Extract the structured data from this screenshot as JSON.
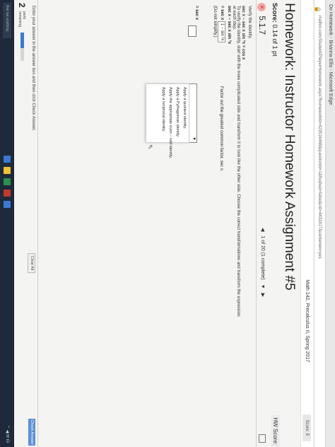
{
  "browser": {
    "tab_text": "Do Homework - Brianna Ellis - Microsoft Edge",
    "url": "mathxl.com/Student/PlayerHomework.aspx?homeworkId=423516468&questionId=1&flushed=false&cId=4431817&centerwin=yes"
  },
  "course": {
    "name": "Math 142, Precalculus II, Spring 2017",
    "right_icon_label": "Score: E"
  },
  "homework": {
    "title": "Homework: Instructor Homework Assignment #5",
    "score_label": "Score:",
    "score_value": "0.14 of 1 pt",
    "hw_score": "HW Score:",
    "question_number": "5.1.7",
    "nav_text": "1 of 20 (1 complete)"
  },
  "problem": {
    "instruction": "Verify the identity.",
    "identity": "sec x − sec x sin ²x = cos x",
    "description": "To verify the identity, start with the more complicated side and transform it to look like the other side. Choose the correct transformations and transform the expression at each step.",
    "step1": "sec x − sec x sin ²x",
    "step2_prefix": "= sec x",
    "step2_boxed": "1 − sin ²x",
    "step2_note": "(Do not simplify.)",
    "step3_prefix": "= sec x",
    "factor_note": "Factor out the greatest common factor, sec x."
  },
  "dropdown": {
    "options": [
      "Apply a quotient identity.",
      "Apply a Pythagorean identity.",
      "Apply the appropriate even – odd identity.",
      "Apply a reciprocal identity."
    ]
  },
  "footer": {
    "message": "Enter your answer in the answer box and then click Check Answer.",
    "remaining_count": "2",
    "remaining_label_1": "parts",
    "remaining_label_2": "remaining",
    "progress": 0.55,
    "clear_label": "Clear All",
    "check_label": "Check Answer"
  },
  "taskbar": {
    "search_placeholder": "Ask me anything"
  },
  "colors": {
    "accent": "#3b79d1",
    "check_button": "#5b8fd6",
    "incorrect_badge": "#f4a7a7"
  }
}
